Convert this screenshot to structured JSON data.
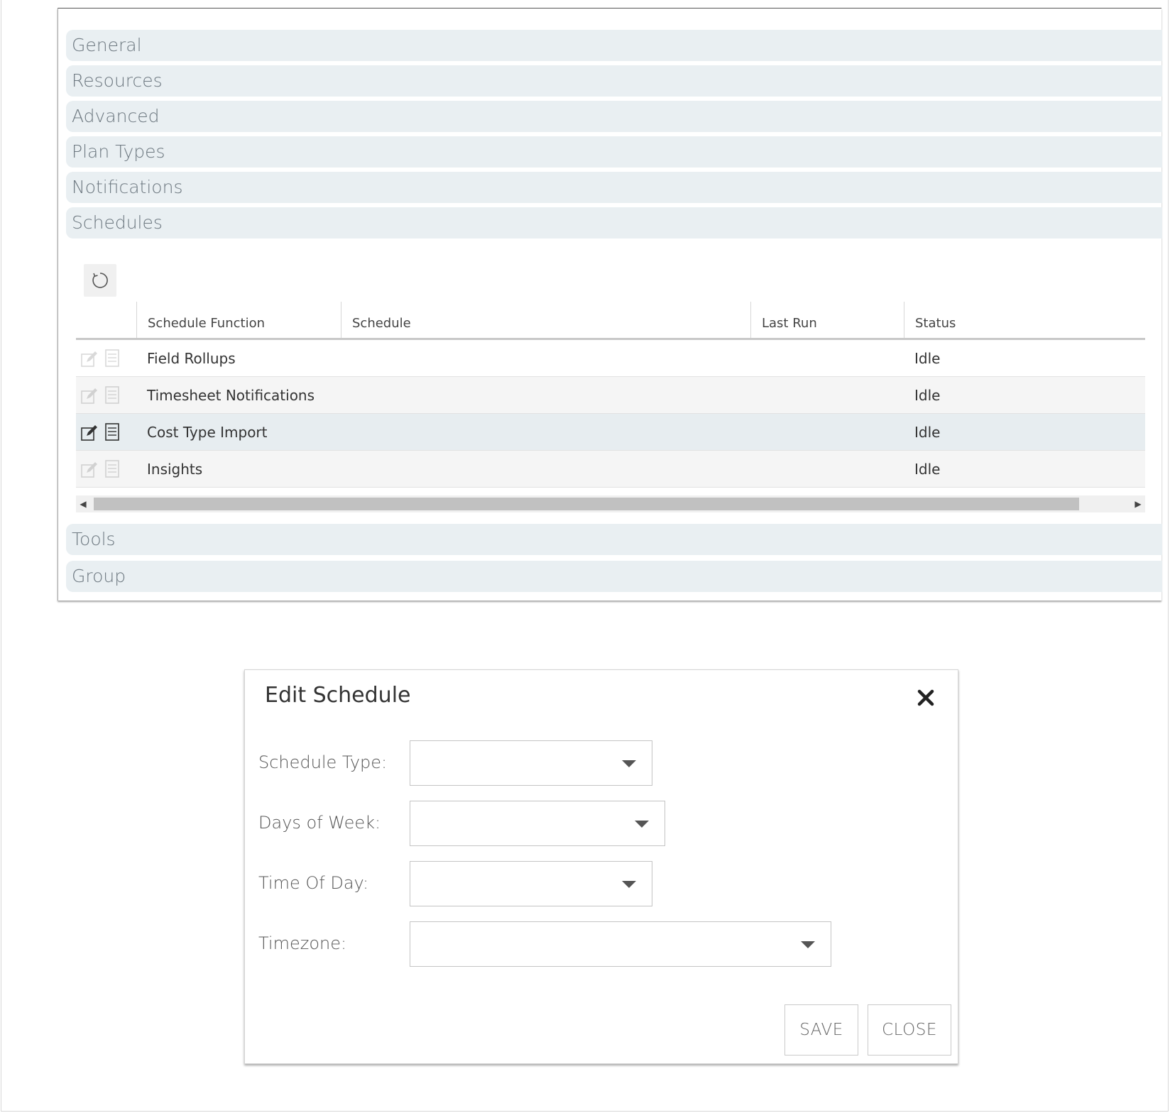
{
  "sections": {
    "general": "General",
    "resources": "Resources",
    "advanced": "Advanced",
    "plan_types": "Plan Types",
    "notifications": "Notifications",
    "schedules": "Schedules",
    "tools": "Tools",
    "group": "Group"
  },
  "grid": {
    "columns": {
      "schedule_function": "Schedule Function",
      "schedule": "Schedule",
      "last_run": "Last Run",
      "status": "Status"
    },
    "rows": [
      {
        "function": "Field Rollups",
        "schedule": "",
        "last_run": "",
        "status": "Idle"
      },
      {
        "function": "Timesheet Notifications",
        "schedule": "",
        "last_run": "",
        "status": "Idle"
      },
      {
        "function": "Cost Type Import",
        "schedule": "",
        "last_run": "",
        "status": "Idle"
      },
      {
        "function": "Insights",
        "schedule": "",
        "last_run": "",
        "status": "Idle"
      }
    ]
  },
  "dialog": {
    "title": "Edit Schedule",
    "fields": {
      "schedule_type": {
        "label": "Schedule Type:",
        "value": ""
      },
      "days_of_week": {
        "label": "Days of Week:",
        "value": ""
      },
      "time_of_day": {
        "label": "Time Of Day:",
        "value": ""
      },
      "timezone": {
        "label": "Timezone:",
        "value": ""
      }
    },
    "save_label": "SAVE",
    "close_label": "CLOSE"
  },
  "icons": {
    "refresh": "refresh-icon",
    "edit": "edit-icon",
    "details": "details-icon",
    "close": "close-icon",
    "caret": "chevron-down-icon"
  },
  "colors": {
    "section_bg": "#e9eff2",
    "section_text": "#6d7880",
    "row_alt": "#f5f5f5",
    "row_hover": "#e7edf0"
  }
}
